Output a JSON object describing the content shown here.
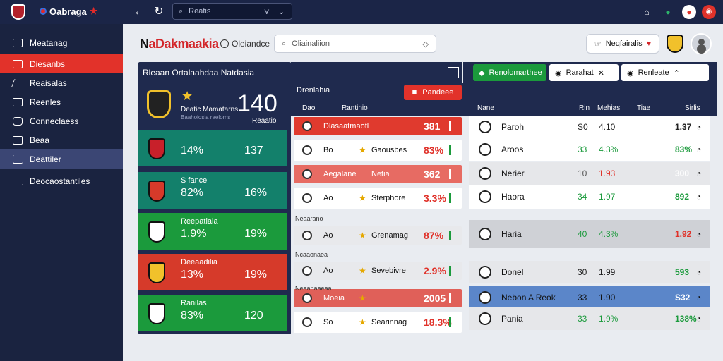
{
  "topbar": {
    "brand": "Oabraga",
    "search_text": "Reatis"
  },
  "sidebar": {
    "items": [
      {
        "label": "Meatanag"
      },
      {
        "label": "Diesanbs"
      },
      {
        "label": "Reaisalas"
      },
      {
        "label": "Reenles"
      },
      {
        "label": "Conneclaess"
      },
      {
        "label": "Beaa"
      },
      {
        "label": "Deattiler"
      },
      {
        "label": "Deocaostantiles"
      }
    ]
  },
  "header": {
    "title_a": "N",
    "title_b": "aDakmaakia",
    "subtitle": "Oleiandce",
    "search_placeholder": "Oliainaliion",
    "pill_label": "Neqfairalis"
  },
  "left_panel": {
    "title": "Rleaan Ortalaahdaa Natdasia",
    "featured": {
      "name": "Deatic Mamatarns",
      "sub": "Baahoiosia raeloms",
      "score": "140",
      "score_label": "Reaatio"
    },
    "rows": [
      {
        "label": "",
        "p1": "14%",
        "p2": "137",
        "bg": "#13806b"
      },
      {
        "label": "S fance",
        "p1": "82%",
        "p2": "16%",
        "bg": "#13806b"
      },
      {
        "label": "Reepatiaia",
        "p1": "1.9%",
        "p2": "19%",
        "bg": "#1b9a3c"
      },
      {
        "label": "Deeaadilia",
        "p1": "13%",
        "p2": "19%",
        "bg": "#d63a2a"
      },
      {
        "label": "Ranilas",
        "p1": "83%",
        "p2": "120",
        "bg": "#1b9a3c"
      }
    ]
  },
  "middle": {
    "heading": "Drenlahia",
    "button_label": "Pandeee",
    "col_a": "Dao",
    "col_b": "Rantinio",
    "sep_labels": [
      "Neaarano",
      "Ncaaonaea",
      "Neaanaaeaa"
    ],
    "rows": [
      {
        "t1": "Dlasaatmaotl",
        "t2": "",
        "v": "381",
        "bg": "#e03a2e",
        "fg": "#fff",
        "star": false,
        "bar": "#fff"
      },
      {
        "t1": "Bo",
        "t2": "Gaousbes",
        "v": "83%",
        "bg": "#ffffff",
        "fg": "#111",
        "star": true,
        "bar": "#1b9a3c",
        "vcol": "#e0322a"
      },
      {
        "t1": "Aegalane",
        "t2": "Netia",
        "v": "362",
        "bg": "#e76b63",
        "fg": "#fff",
        "star": false,
        "bar": "#fff"
      },
      {
        "t1": "Ao",
        "t2": "Sterphore",
        "v": "3.3%",
        "bg": "#ffffff",
        "fg": "#111",
        "star": true,
        "bar": "#1b9a3c",
        "vcol": "#e0322a"
      },
      {
        "t1": "Ao",
        "t2": "Grenamag",
        "v": "87%",
        "bg": "#e8e9ec",
        "fg": "#111",
        "star": true,
        "bar": "#1b9a3c",
        "vcol": "#e0322a"
      },
      {
        "t1": "Ao",
        "t2": "Sevebivre",
        "v": "2.9%",
        "bg": "#e8e9ec",
        "fg": "#111",
        "star": true,
        "bar": "#1b9a3c",
        "vcol": "#e0322a"
      },
      {
        "t1": "Moeia",
        "t2": "",
        "v": "2005",
        "bg": "#e06059",
        "fg": "#fff",
        "star": true,
        "bar": "#fff"
      },
      {
        "t1": "So",
        "t2": "Searinnag",
        "v": "18.3%",
        "bg": "#ffffff",
        "fg": "#111",
        "star": true,
        "bar": "#1b9a3c",
        "vcol": "#e0322a"
      }
    ]
  },
  "right": {
    "tabs": [
      {
        "label": "Renolomarthee",
        "bg": "#1b9a3c",
        "fg": "#fff"
      },
      {
        "label": "Rarahat",
        "bg": "#ffffff",
        "fg": "#111"
      },
      {
        "label": "Renleate",
        "bg": "#ffffff",
        "fg": "#111"
      }
    ],
    "cols": [
      "Nane",
      "Rin",
      "Mehias",
      "Tiae",
      "Sirlis"
    ],
    "rows": [
      {
        "n": "Paroh",
        "a": "S0",
        "b": "4.10",
        "c": "1.37",
        "bg": "#ffffff",
        "ac": "#222",
        "bc": "#222",
        "cc": "#222"
      },
      {
        "n": "Aroos",
        "a": "33",
        "b": "4.3%",
        "c": "83%",
        "bg": "#ffffff",
        "ac": "#1b9a3c",
        "bc": "#1b9a3c",
        "cc": "#1b9a3c"
      },
      {
        "n": "Nerier",
        "a": "10",
        "b": "1.93",
        "c": "300",
        "bg": "#e6e7ea",
        "ac": "#555",
        "bc": "#e0322a",
        "cc": "#fff"
      },
      {
        "n": "Haora",
        "a": "34",
        "b": "1.97",
        "c": "892",
        "bg": "#ffffff",
        "ac": "#1b9a3c",
        "bc": "#1b9a3c",
        "cc": "#1b9a3c"
      },
      {
        "n": "Haria",
        "a": "40",
        "b": "4.3%",
        "c": "1.92",
        "bg": "#cfd1d6",
        "ac": "#1b9a3c",
        "bc": "#1b9a3c",
        "cc": "#e0322a"
      },
      {
        "n": "Donel",
        "a": "30",
        "b": "1.99",
        "c": "593",
        "bg": "#e6e7ea",
        "ac": "#222",
        "bc": "#222",
        "cc": "#1b9a3c"
      },
      {
        "n": "Nebon A Reok",
        "a": "33",
        "b": "1.90",
        "c": "S32",
        "bg": "#5b86c9",
        "ac": "#111",
        "bc": "#111",
        "cc": "#fff"
      },
      {
        "n": "Pania",
        "a": "33",
        "b": "1.9%",
        "c": "138%",
        "bg": "#e6e7ea",
        "ac": "#1b9a3c",
        "bc": "#1b9a3c",
        "cc": "#1b9a3c"
      }
    ]
  }
}
